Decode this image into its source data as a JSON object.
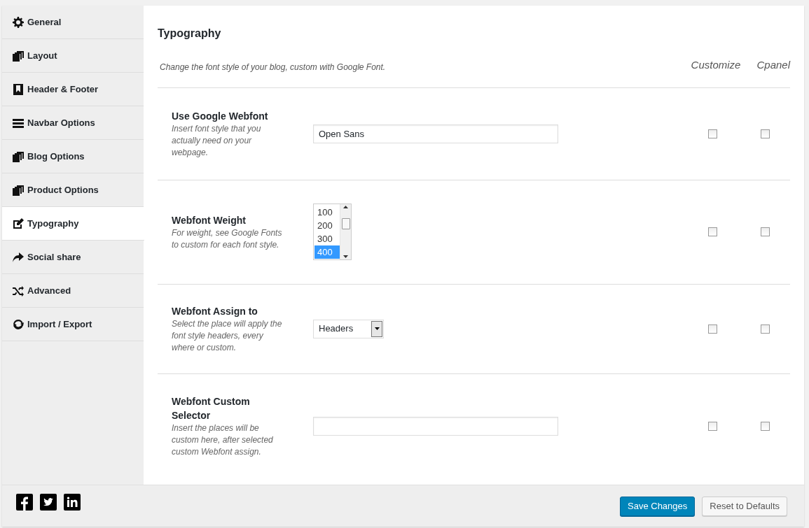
{
  "sidebar": {
    "items": [
      {
        "label": "General",
        "selected": false
      },
      {
        "label": "Layout",
        "selected": false
      },
      {
        "label": "Header & Footer",
        "selected": false
      },
      {
        "label": "Navbar Options",
        "selected": false
      },
      {
        "label": "Blog Options",
        "selected": false
      },
      {
        "label": "Product Options",
        "selected": false
      },
      {
        "label": "Typography",
        "selected": true
      },
      {
        "label": "Social share",
        "selected": false
      },
      {
        "label": "Advanced",
        "selected": false
      },
      {
        "label": "Import / Export",
        "selected": false
      }
    ]
  },
  "section": {
    "title": "Typography",
    "description": "Change the font style of your blog, custom with Google Font.",
    "columns": [
      "Customize",
      "Cpanel"
    ]
  },
  "options": [
    {
      "kind": "text",
      "label": "Use Google Webfont",
      "help": "Insert font style that you actually need on your webpage.",
      "value": "Open Sans",
      "customize": false,
      "cpanel": false
    },
    {
      "kind": "listbox",
      "label": "Webfont Weight",
      "help": "For weight, see Google Fonts to custom for each font style.",
      "items": [
        {
          "label": "100",
          "selected": false
        },
        {
          "label": "200",
          "selected": false
        },
        {
          "label": "300",
          "selected": false
        },
        {
          "label": "400",
          "selected": true
        }
      ],
      "customize": false,
      "cpanel": false
    },
    {
      "kind": "select",
      "label": "Webfont Assign to",
      "help": "Select the place will apply the font style headers, every where or custom.",
      "value": "Headers",
      "customize": false,
      "cpanel": false
    },
    {
      "kind": "text",
      "label": "Webfont Custom Selector",
      "help": "Insert the places will be custom here, after selected custom Webfont assign.",
      "customize": false,
      "cpanel": false
    }
  ],
  "footer": {
    "buttons": [
      {
        "label": "Save Changes",
        "kind": "primary"
      },
      {
        "label": "Reset to Defaults",
        "kind": "secondary"
      }
    ]
  }
}
